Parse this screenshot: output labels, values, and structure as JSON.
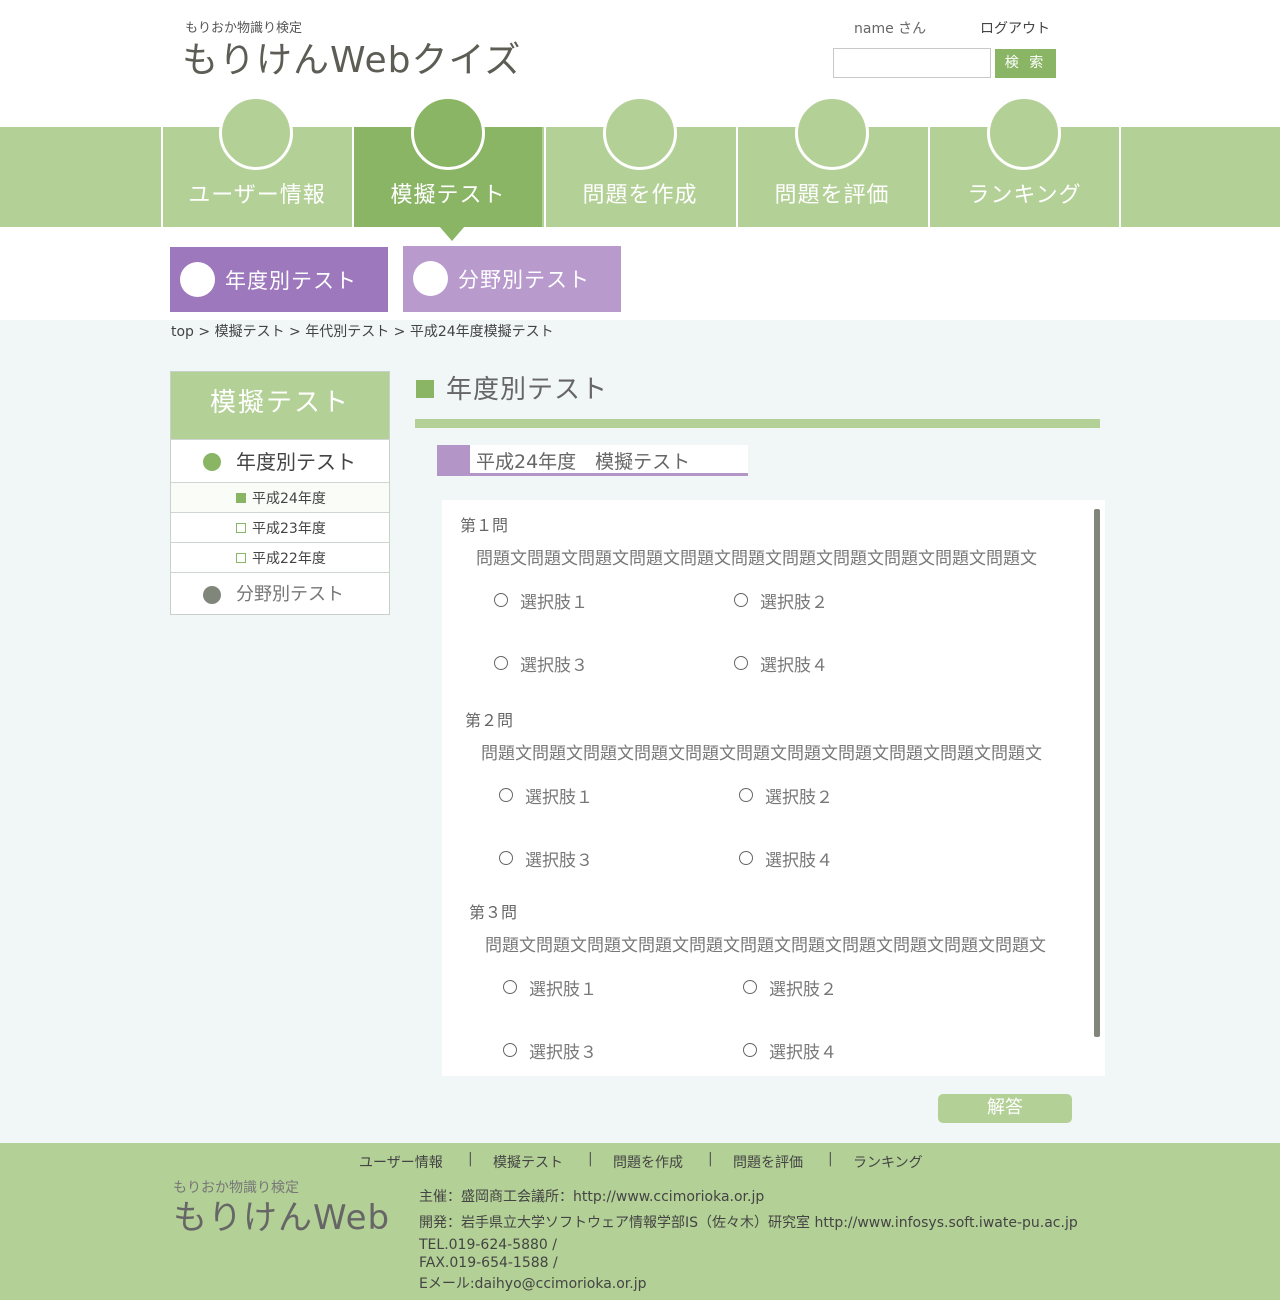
{
  "header": {
    "subtitle": "もりおか物識り検定",
    "title": "もりけんWebクイズ",
    "user_name": "name さん",
    "logout": "ログアウト",
    "search_value": "",
    "search_button": "検 索"
  },
  "nav": {
    "tabs": [
      {
        "label": "ユーザー情報",
        "active": false
      },
      {
        "label": "模擬テスト",
        "active": true
      },
      {
        "label": "問題を作成",
        "active": false
      },
      {
        "label": "問題を評価",
        "active": false
      },
      {
        "label": "ランキング",
        "active": false
      }
    ]
  },
  "subnav": {
    "tabs": [
      {
        "label": "年度別テスト",
        "color": "#9e78bc"
      },
      {
        "label": "分野別テスト",
        "color": "#b89bcc"
      }
    ]
  },
  "breadcrumb": "top > 模擬テスト > 年代別テスト > 平成24年度模擬テスト",
  "sidebar": {
    "title": "模擬テスト",
    "section1": "年度別テスト",
    "years": [
      "平成24年度",
      "平成23年度",
      "平成22年度"
    ],
    "section2": "分野別テスト"
  },
  "main": {
    "title": "年度別テスト",
    "section_title": "平成24年度　模擬テスト",
    "questions": [
      {
        "number": "第１問",
        "text": "問題文問題文問題文問題文問題文問題文問題文問題文問題文問題文問題文",
        "options": [
          "選択肢１",
          "選択肢２",
          "選択肢３",
          "選択肢４"
        ]
      },
      {
        "number": "第２問",
        "text": "問題文問題文問題文問題文問題文問題文問題文問題文問題文問題文問題文",
        "options": [
          "選択肢１",
          "選択肢２",
          "選択肢３",
          "選択肢４"
        ]
      },
      {
        "number": "第３問",
        "text": "問題文問題文問題文問題文問題文問題文問題文問題文問題文問題文問題文",
        "options": [
          "選択肢１",
          "選択肢２",
          "選択肢３",
          "選択肢４"
        ]
      }
    ],
    "answer_button": "解答"
  },
  "footer": {
    "nav": [
      "ユーザー情報",
      "模擬テスト",
      "問題を作成",
      "問題を評価",
      "ランキング"
    ],
    "separator": "|",
    "subtitle": "もりおか物識り検定",
    "logo": "もりけんWeb",
    "sponsor": "主催：盛岡商工会議所：http://www.ccimorioka.or.jp",
    "developer": "開発：岩手県立大学ソフトウェア情報学部IS（佐々木）研究室 http://www.infosys.soft.iwate-pu.ac.jp",
    "tel": "TEL.019-624-5880 /",
    "fax": "FAX.019-654-1588 /",
    "email": "Eメール:daihyo@ccimorioka.or.jp"
  },
  "colors": {
    "green_light": "#b3d096",
    "green_dark": "#8ab565",
    "purple_dark": "#9e78bc",
    "purple_light": "#b89bcc",
    "content_bg": "#f1f7f7"
  }
}
